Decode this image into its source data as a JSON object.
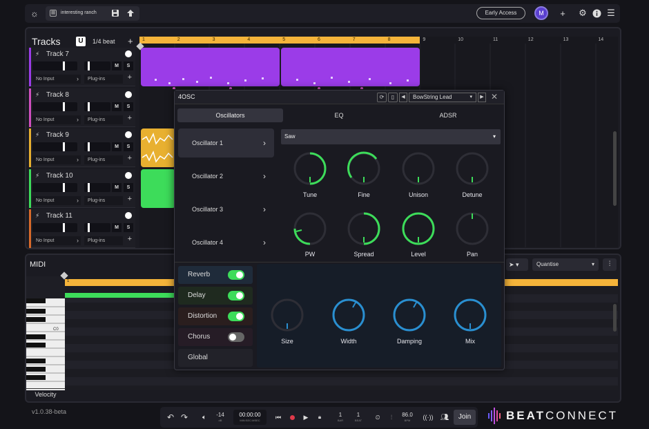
{
  "topbar": {
    "project_name": "interesting ranch",
    "early_access": "Early Access",
    "avatar_letter": "M"
  },
  "tracks_panel": {
    "title": "Tracks",
    "grid": "1/4 beat",
    "snap_letter": "U"
  },
  "tracks": [
    {
      "name": "Track 7",
      "color": "#9b3ce8",
      "input": "No Input",
      "plugins": "Plug-ins"
    },
    {
      "name": "Track 8",
      "color": "#d04fc0",
      "input": "No Input",
      "plugins": "Plug-ins"
    },
    {
      "name": "Track 9",
      "color": "#e8b030",
      "input": "No Input",
      "plugins": "Plug-ins"
    },
    {
      "name": "Track 10",
      "color": "#3ddc5a",
      "input": "No Input",
      "plugins": "Plug-ins"
    },
    {
      "name": "Track 11",
      "color": "#d86a2a",
      "input": "No Input",
      "plugins": "Plug-ins"
    }
  ],
  "ruler": [
    "1",
    "2",
    "3",
    "4",
    "5",
    "6",
    "7",
    "8",
    "9",
    "10",
    "11",
    "12",
    "13",
    "14"
  ],
  "plugin": {
    "title": "4OSC",
    "preset": "BowString Lead",
    "tabs": [
      "Oscillators",
      "EQ",
      "ADSR"
    ],
    "oscillators": [
      "Oscillator 1",
      "Oscillator 2",
      "Oscillator 3",
      "Oscillator 4"
    ],
    "waveform": "Saw",
    "knobs_row1": [
      "Tune",
      "Fine",
      "Unison",
      "Detune"
    ],
    "knobs_row2": [
      "PW",
      "Spread",
      "Level",
      "Pan"
    ],
    "effects": [
      {
        "name": "Reverb",
        "on": true
      },
      {
        "name": "Delay",
        "on": true
      },
      {
        "name": "Distortion",
        "on": true
      },
      {
        "name": "Chorus",
        "on": false
      },
      {
        "name": "Global"
      }
    ],
    "reverb_knobs": [
      "Size",
      "Width",
      "Damping",
      "Mix"
    ]
  },
  "midi": {
    "title": "MIDI",
    "quantise": "Quantise",
    "c0": "C0",
    "velocity": "Velocity",
    "ruler_start": "1"
  },
  "version": "v1.0.38-beta",
  "transport": {
    "volume": "-14",
    "volume_unit": "dB",
    "time": "00:00:00",
    "time_unit": "MIN:SEC:MSEC",
    "bar": "1",
    "bar_unit": "BAR",
    "beat": "1",
    "beat_unit": "BEAT",
    "bpm": "86.0",
    "bpm_unit": "BPM",
    "join": "Join"
  },
  "brand": {
    "word1": "BEAT",
    "word2": "CONNECT"
  },
  "colors": {
    "accent_green": "#3ddc5a",
    "ruler_yellow": "#f5b43a",
    "purple_clip": "#9b3ce8",
    "blue_knob": "#2a8fd0"
  }
}
